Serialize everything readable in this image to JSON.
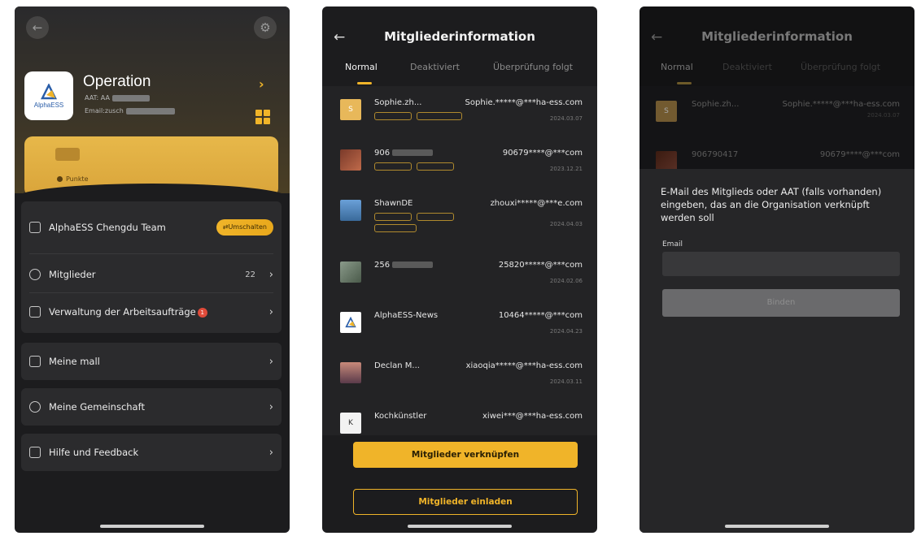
{
  "screen1": {
    "org_name": "Operation",
    "aat_prefix": "AAT: AA",
    "email_prefix": "Email:zusch",
    "points_label": "Punkte",
    "team": {
      "label": "AlphaESS Chengdu Team",
      "switch_label": "Umschalten"
    },
    "menu": [
      {
        "label": "Mitglieder",
        "count": "22"
      },
      {
        "label": "Verwaltung der Arbeitsaufträge",
        "badge": "1"
      },
      {
        "label": "Meine mall"
      },
      {
        "label": "Meine Gemeinschaft"
      },
      {
        "label": "Hilfe und Feedback"
      }
    ],
    "logo_text": "AlphaESS"
  },
  "screen2": {
    "title": "Mitgliederinformation",
    "tabs": [
      "Normal",
      "Deaktiviert",
      "Überprüfung folgt"
    ],
    "members": [
      {
        "name": "Sophie.zh...",
        "email": "Sophie.*****@***ha-ess.com",
        "date": "2024.03.07"
      },
      {
        "name": "906",
        "email": "90679****@***com",
        "date": "2023.12.21"
      },
      {
        "name": "ShawnDE",
        "email": "zhouxi*****@***e.com",
        "date": "2024.04.03"
      },
      {
        "name": "256",
        "email": "25820*****@***com",
        "date": "2024.02.06"
      },
      {
        "name": "AlphaESS-News",
        "email": "10464*****@***com",
        "date": "2024.04.23"
      },
      {
        "name": "Declan M...",
        "email": "xiaoqia*****@***ha-ess.com",
        "date": "2024.03.11"
      },
      {
        "name": "Kochkünstler",
        "email": "xiwei***@***ha-ess.com",
        "date": ""
      }
    ],
    "link_button": "Mitglieder verknüpfen",
    "invite_button": "Mitglieder einladen"
  },
  "screen3": {
    "title": "Mitgliederinformation",
    "tabs": [
      "Normal",
      "Deaktiviert",
      "Überprüfung folgt"
    ],
    "members": [
      {
        "name": "Sophie.zh...",
        "email": "Sophie.*****@***ha-ess.com",
        "date": "2024.03.07"
      },
      {
        "name": "906790417",
        "email": "90679****@***com",
        "date": ""
      }
    ],
    "prompt": "E-Mail des Mitglieds oder AAT (falls vorhanden) eingeben, das an die Organisation verknüpft werden soll",
    "email_label": "Email",
    "email_value": "",
    "submit_label": "Binden"
  },
  "colors": {
    "accent": "#f0b429",
    "background": "#1c1c1e",
    "card": "#2b2b2d"
  }
}
